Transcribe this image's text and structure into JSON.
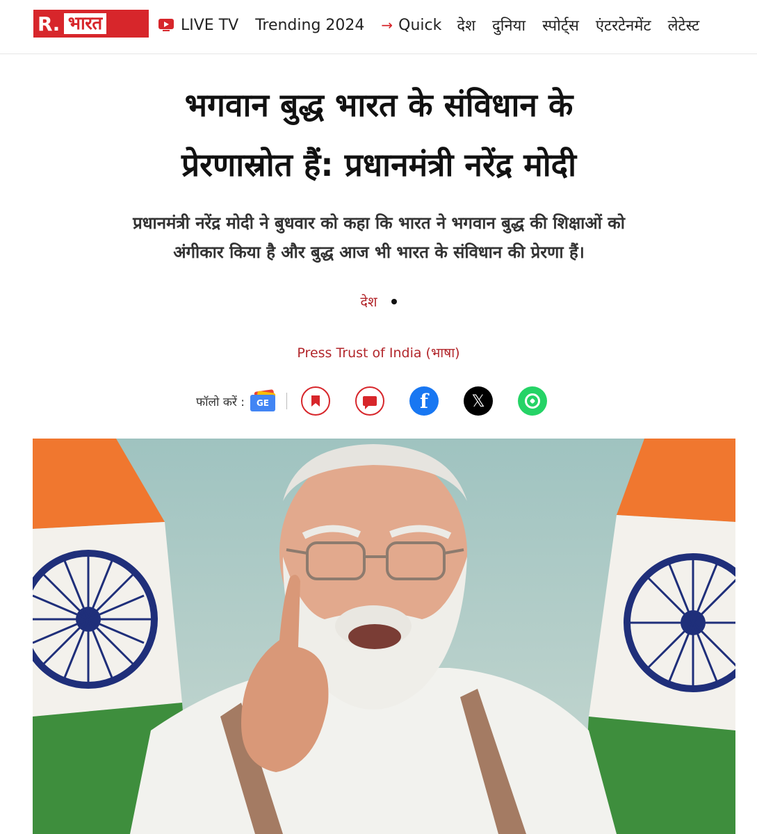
{
  "brand": {
    "logo_r": "R.",
    "logo_b": "भारत"
  },
  "nav": {
    "live": "LIVE TV",
    "trending": "Trending 2024",
    "quick": "Quick",
    "items": [
      "देश",
      "दुनिया",
      "स्पोर्ट्स",
      "एंटरटेनमेंट",
      "लेटेस्ट"
    ]
  },
  "article": {
    "headline_line1": "भगवान बुद्ध भारत के संविधान के",
    "headline_line2": "प्रेरणास्रोत हैं: प्रधानमंत्री नरेंद्र मोदी",
    "summary_line1": "प्रधानमंत्री नरेंद्र मोदी ने बुधवार को कहा कि भारत ने भगवान बुद्ध की शिक्षाओं को",
    "summary_line2": "अंगीकार किया है और बुद्ध आज भी भारत के संविधान की प्रेरणा हैं।",
    "category": "देश",
    "author": "Press Trust of India (भाषा)"
  },
  "share": {
    "follow_label": "फॉलो करें :",
    "gnews_text": "GE",
    "fb_glyph": "f",
    "x_glyph": "𝕏"
  },
  "colors": {
    "brand_red": "#d7262b",
    "link_red": "#b2262b"
  },
  "icons": [
    "live-tv-icon",
    "arrow-right-icon",
    "google-news-icon",
    "bookmark-icon",
    "comment-icon",
    "facebook-icon",
    "x-icon",
    "whatsapp-icon"
  ]
}
